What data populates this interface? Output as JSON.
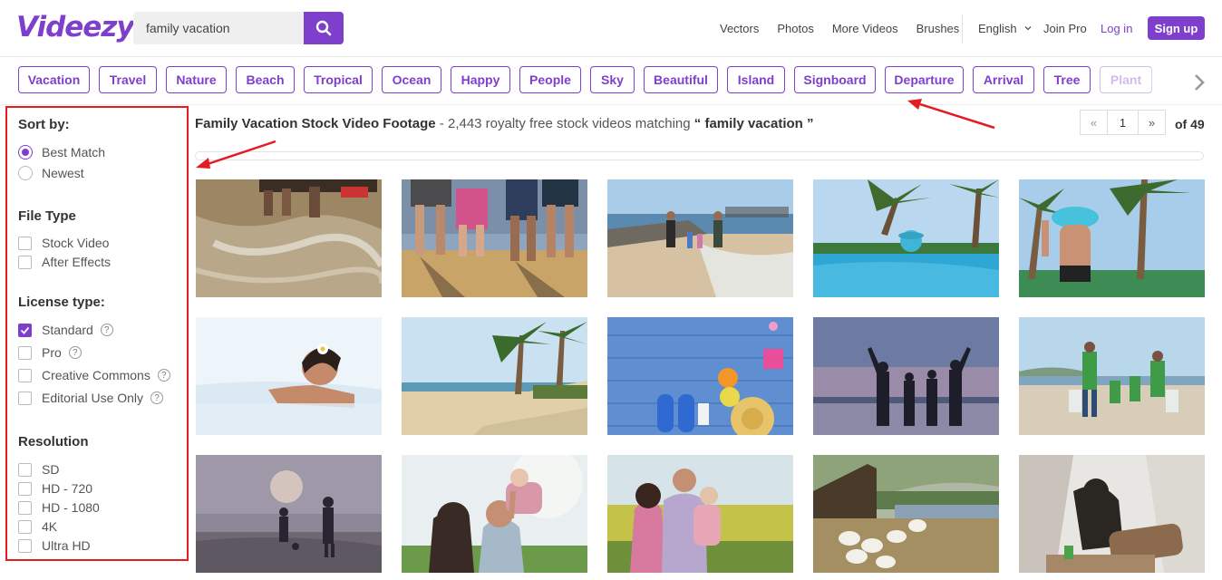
{
  "header": {
    "logo": "Videezy",
    "search": {
      "value": "family vacation",
      "placeholder": ""
    },
    "nav": [
      "Vectors",
      "Photos",
      "More Videos",
      "Brushes"
    ],
    "language": "English",
    "join_pro": "Join Pro",
    "login": "Log in",
    "signup": "Sign up"
  },
  "tags": [
    "Vacation",
    "Travel",
    "Nature",
    "Beach",
    "Tropical",
    "Ocean",
    "Happy",
    "People",
    "Sky",
    "Beautiful",
    "Island",
    "Signboard",
    "Departure",
    "Arrival",
    "Tree",
    "Plant"
  ],
  "sidebar": {
    "sort": {
      "title": "Sort by:",
      "options": [
        {
          "label": "Best Match",
          "selected": true
        },
        {
          "label": "Newest",
          "selected": false
        }
      ]
    },
    "file_type": {
      "title": "File Type",
      "options": [
        {
          "label": "Stock Video",
          "checked": false
        },
        {
          "label": "After Effects",
          "checked": false
        }
      ]
    },
    "license": {
      "title": "License type:",
      "options": [
        {
          "label": "Standard",
          "checked": true,
          "help": "?"
        },
        {
          "label": "Pro",
          "checked": false,
          "help": "?"
        },
        {
          "label": "Creative Commons",
          "checked": false,
          "help": "?"
        },
        {
          "label": "Editorial Use Only",
          "checked": false,
          "help": "?"
        }
      ]
    },
    "resolution": {
      "title": "Resolution",
      "options": [
        {
          "label": "SD",
          "checked": false
        },
        {
          "label": "HD - 720",
          "checked": false
        },
        {
          "label": "HD - 1080",
          "checked": false
        },
        {
          "label": "4K",
          "checked": false
        },
        {
          "label": "Ultra HD",
          "checked": false
        }
      ]
    }
  },
  "results": {
    "title": "Family Vacation Stock Video Footage",
    "summary_prefix": " - 2,443 royalty free stock videos matching ",
    "query_quoted": "“ family vacation ”",
    "page": "1",
    "of_pages": "of 49",
    "prev_icon": "«",
    "next_icon": "»"
  },
  "thumbnails": [
    "feet-in-sea-foam",
    "family-walking-on-beach",
    "family-walking-beach-shoreline",
    "woman-in-infinity-pool",
    "woman-with-hat-palm-trees",
    "woman-in-water-flower-hair",
    "tropical-beach-palms",
    "beach-items-flatlay-blue-wood",
    "family-silhouette-sunset",
    "family-walking-beach-green-shirts",
    "father-son-football-sunset",
    "father-lifting-child",
    "family-portrait-field",
    "ducks-near-farm-pond",
    "chimpanzee-on-log"
  ],
  "colors": {
    "accent": "#7e3fcc",
    "annotation": "#e31b23"
  },
  "icons": {
    "search": "search-icon",
    "next": "chevron-right-icon",
    "dropdown": "chevron-down-icon",
    "help": "help-icon",
    "check": "check-icon"
  }
}
